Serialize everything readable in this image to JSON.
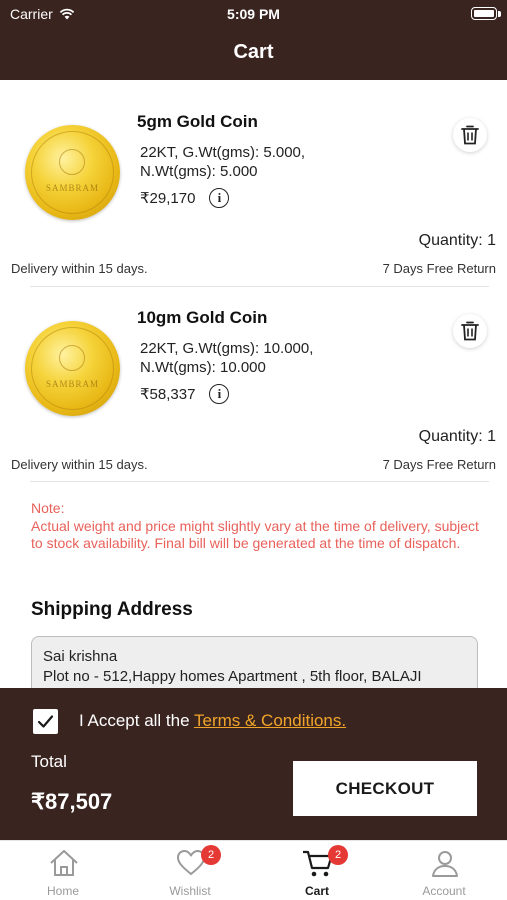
{
  "status_bar": {
    "carrier": "Carrier",
    "time": "5:09 PM"
  },
  "header": {
    "title": "Cart"
  },
  "cart_items": [
    {
      "name": "5gm Gold Coin",
      "spec_line1": "22KT, G.Wt(gms): 5.000,",
      "spec_line2": "N.Wt(gms): 5.000",
      "price": "₹29,170",
      "quantity": "Quantity: 1",
      "delivery": "Delivery within 15 days.",
      "returns": "7 Days Free Return",
      "image_icon": "gold-coin-image",
      "coin_text": "SAMBRAM"
    },
    {
      "name": "10gm Gold Coin",
      "spec_line1": "22KT, G.Wt(gms): 10.000,",
      "spec_line2": "N.Wt(gms): 10.000",
      "price": "₹58,337",
      "quantity": "Quantity: 1",
      "delivery": "Delivery within 15 days.",
      "returns": "7 Days Free Return",
      "image_icon": "gold-coin-image",
      "coin_text": "SAMBRAM"
    }
  ],
  "note": {
    "label": "Note:",
    "text": "Actual weight and price might slightly vary at the time of delivery, subject to stock availability. Final bill will be generated at the time of dispatch."
  },
  "shipping": {
    "title": "Shipping Address",
    "name": "Sai krishna",
    "address_line": "Plot no - 512,Happy homes Apartment , 5th floor, BALAJI"
  },
  "checkout": {
    "terms_prefix": "I Accept all the",
    "terms_link": "Terms & Conditions.",
    "checked": true,
    "total_label": "Total",
    "total_value": "₹87,507",
    "button_label": "CHECKOUT"
  },
  "tabs": [
    {
      "label": "Home",
      "icon": "home-icon",
      "badge": ""
    },
    {
      "label": "Wishlist",
      "icon": "heart-icon",
      "badge": "2"
    },
    {
      "label": "Cart",
      "icon": "cart-icon",
      "badge": "2",
      "active": true
    },
    {
      "label": "Account",
      "icon": "account-icon",
      "badge": ""
    }
  ],
  "colors": {
    "brand_dark": "#3a2420",
    "link_accent": "#f0a52a",
    "note_red": "#e8615a",
    "badge_red": "#e53935"
  }
}
